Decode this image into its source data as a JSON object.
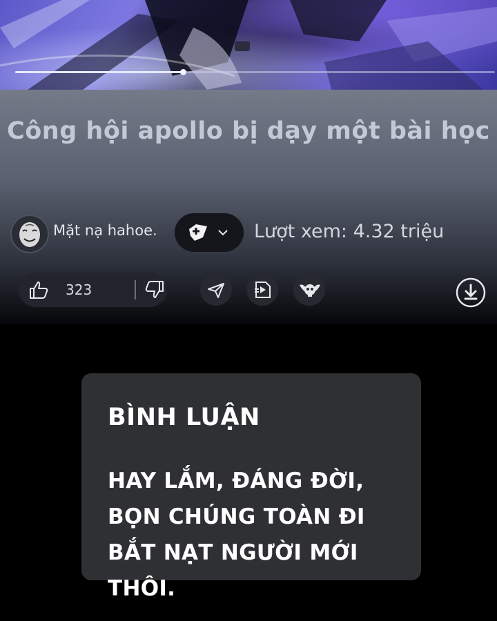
{
  "player": {
    "progress_fraction": 0.35
  },
  "video": {
    "title": "Công hội apollo bị dạy một bài học"
  },
  "channel": {
    "name": "Mặt nạ hahoe."
  },
  "views": {
    "label": "Lượt xem:",
    "value": "4.32 triệu"
  },
  "actions": {
    "like_count": "323"
  },
  "comment": {
    "heading": "BÌNH LUẬN",
    "body": "HAY LẮM, ĐÁNG ĐỜI, BỌN CHÚNG TOÀN ĐI BẮT NẠT NGƯỜI MỚI THÔI."
  },
  "colors": {
    "panel_top": "#747a88",
    "background": "#000000",
    "card": "#2f3033",
    "title_text": "#c4c9d6"
  },
  "icons": [
    "mask-avatar",
    "diamond-badge-icon",
    "chevron-down-icon",
    "thumbs-up-icon",
    "thumbs-down-icon",
    "share-icon",
    "remix-icon",
    "winged-skull-icon",
    "download-icon"
  ]
}
